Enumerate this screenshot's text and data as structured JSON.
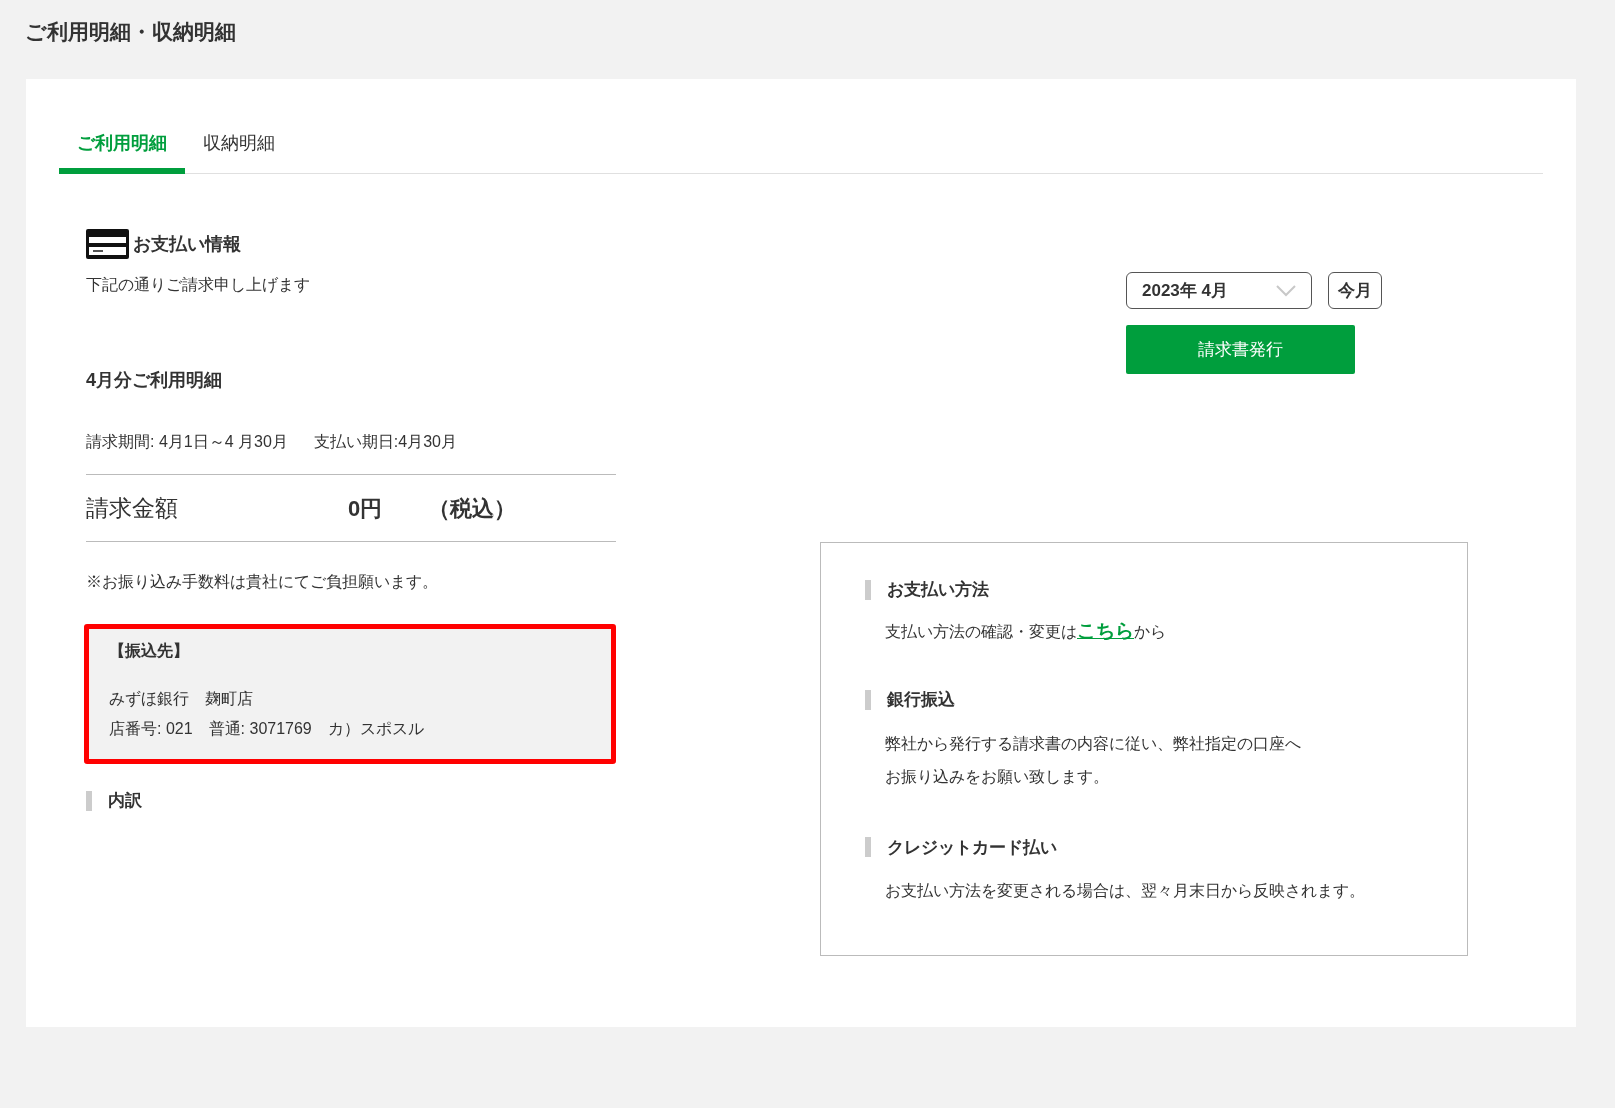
{
  "page_title": "ご利用明細・収納明細",
  "tabs": [
    {
      "label": "ご利用明細",
      "selected": true
    },
    {
      "label": "収納明細",
      "selected": false
    }
  ],
  "payment_info": {
    "title": "お支払い情報",
    "subtitle": "下記の通りご請求申し上げます"
  },
  "month_select": {
    "value": "2023年 4月"
  },
  "this_month_button": "今月",
  "issue_invoice_button": "請求書発行",
  "statement": {
    "title": "4月分ご利用明細",
    "period": "請求期間: 4月1日～4 月30月",
    "due_date": "支払い期日:4月30月",
    "amount_label": "請求金額",
    "amount": "0円",
    "tax_note": "（税込）",
    "fee_note": "※お振り込み手数料は貴社にてご負担願います。"
  },
  "transfer_box": {
    "title": "【振込先】",
    "bank": "みずほ銀行　麹町店",
    "account": "店番号: 021　普通: 3071769　カ）スポスル"
  },
  "breakdown_heading": "内訳",
  "payment_methods": [
    {
      "kind": "link",
      "heading": "お支払い方法",
      "before": "支払い方法の確認・変更は",
      "link": "こちら",
      "after": "から"
    },
    {
      "kind": "text",
      "heading": "銀行振込",
      "lines": [
        "弊社から発行する請求書の内容に従い、弊社指定の口座へ",
        "お振り込みをお願い致します。"
      ]
    },
    {
      "kind": "text",
      "heading": "クレジットカード払い",
      "lines": [
        "お支払い方法を変更される場合は、翌々月末日から反映されます。"
      ]
    }
  ]
}
